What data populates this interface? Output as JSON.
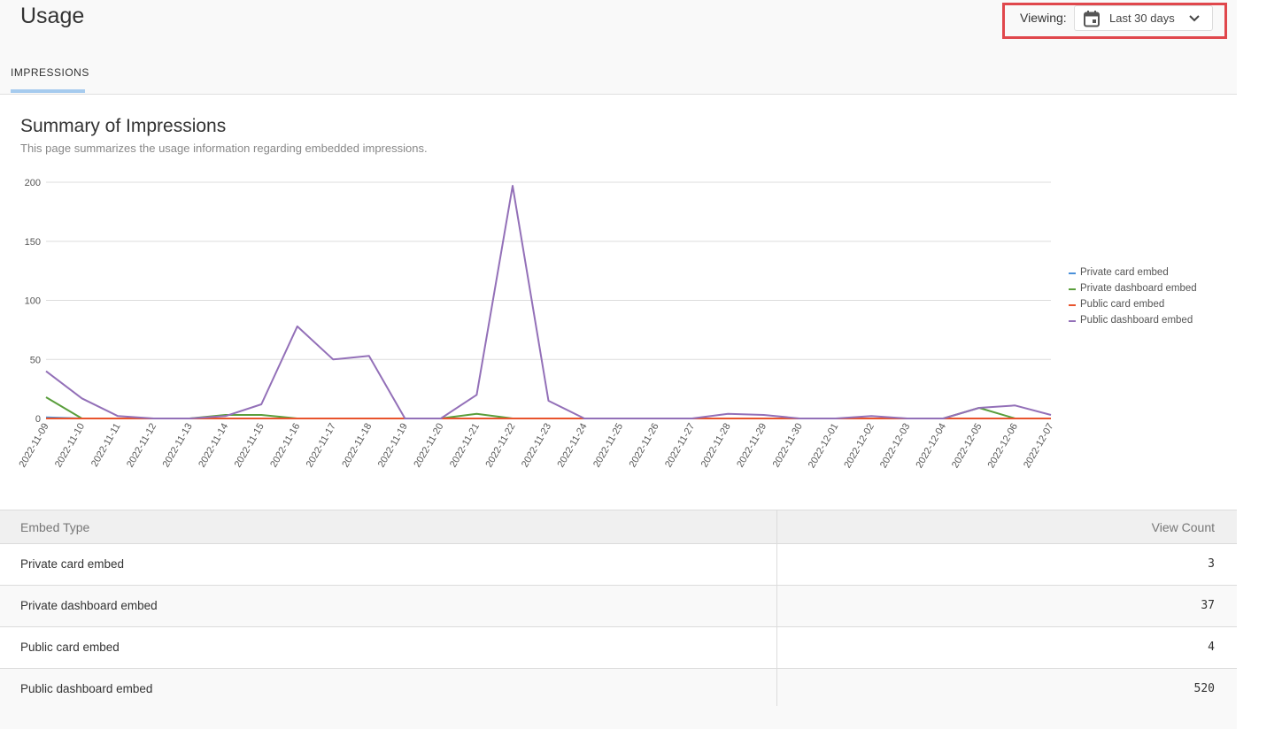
{
  "header": {
    "title": "Usage"
  },
  "viewing": {
    "label": "Viewing:",
    "selected": "Last 30 days",
    "calendar_icon": "calendar-icon",
    "chevron_icon": "chevron-down-icon"
  },
  "tabs": [
    {
      "label": "IMPRESSIONS",
      "active": true
    }
  ],
  "summary": {
    "title": "Summary of Impressions",
    "subtitle": "This page summarizes the usage information regarding embedded impressions."
  },
  "chart_data": {
    "type": "line",
    "x": [
      "2022-11-09",
      "2022-11-10",
      "2022-11-11",
      "2022-11-12",
      "2022-11-13",
      "2022-11-14",
      "2022-11-15",
      "2022-11-16",
      "2022-11-17",
      "2022-11-18",
      "2022-11-19",
      "2022-11-20",
      "2022-11-21",
      "2022-11-22",
      "2022-11-23",
      "2022-11-24",
      "2022-11-25",
      "2022-11-26",
      "2022-11-27",
      "2022-11-28",
      "2022-11-29",
      "2022-11-30",
      "2022-12-01",
      "2022-12-02",
      "2022-12-03",
      "2022-12-04",
      "2022-12-05",
      "2022-12-06",
      "2022-12-07"
    ],
    "ylim": [
      0,
      200
    ],
    "yticks": [
      0,
      50,
      100,
      150,
      200
    ],
    "grid": true,
    "legend": "right",
    "series": [
      {
        "name": "Private card embed",
        "color": "#4a90d9",
        "values": [
          1,
          0,
          0,
          0,
          0,
          0,
          0,
          0,
          0,
          0,
          0,
          0,
          0,
          0,
          0,
          0,
          0,
          0,
          0,
          0,
          0,
          0,
          0,
          0,
          0,
          0,
          0,
          0,
          0
        ]
      },
      {
        "name": "Private dashboard embed",
        "color": "#5a9e3c",
        "values": [
          18,
          0,
          0,
          0,
          0,
          3,
          3,
          0,
          0,
          0,
          0,
          0,
          4,
          0,
          0,
          0,
          0,
          0,
          0,
          0,
          0,
          0,
          0,
          0,
          0,
          0,
          9,
          0,
          0
        ]
      },
      {
        "name": "Public card embed",
        "color": "#e8542d",
        "values": [
          0,
          0,
          0,
          0,
          0,
          0,
          0,
          0,
          0,
          0,
          0,
          0,
          0,
          0,
          0,
          0,
          0,
          0,
          0,
          0,
          0,
          0,
          0,
          0,
          0,
          0,
          0,
          0,
          0
        ]
      },
      {
        "name": "Public dashboard embed",
        "color": "#9370b8",
        "values": [
          40,
          17,
          2,
          0,
          0,
          2,
          12,
          78,
          50,
          53,
          0,
          0,
          20,
          197,
          15,
          0,
          0,
          0,
          0,
          4,
          3,
          0,
          0,
          2,
          0,
          0,
          9,
          11,
          3
        ]
      }
    ]
  },
  "table": {
    "headers": [
      "Embed Type",
      "View Count"
    ],
    "rows": [
      [
        "Private card embed",
        "3"
      ],
      [
        "Private dashboard embed",
        "37"
      ],
      [
        "Public card embed",
        "4"
      ],
      [
        "Public dashboard embed",
        "520"
      ]
    ]
  }
}
